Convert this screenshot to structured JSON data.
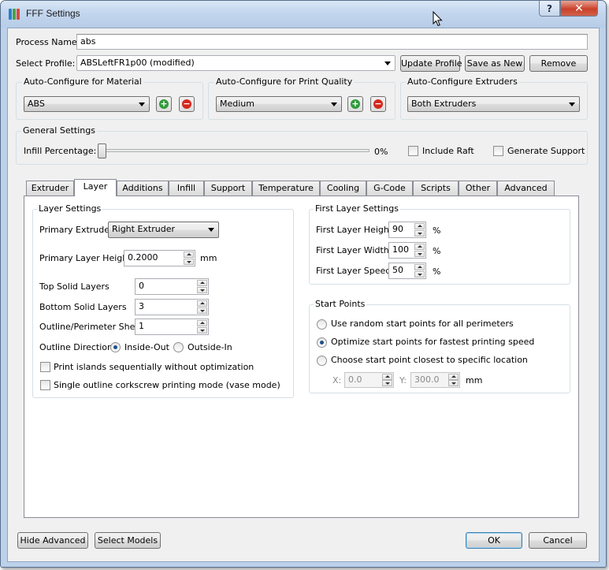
{
  "window": {
    "title": "FFF Settings",
    "help_label": "?",
    "close_label": "✕",
    "icon": "app-icon"
  },
  "process": {
    "name_label": "Process Name:",
    "name_value": "abs",
    "profile_label": "Select Profile:",
    "profile_value": "ABSLeftFR1p00 (modified)",
    "update_button": "Update Profile",
    "save_as_button": "Save as New",
    "remove_button": "Remove"
  },
  "auto_material": {
    "title": "Auto-Configure for Material",
    "value": "ABS"
  },
  "auto_quality": {
    "title": "Auto-Configure for Print Quality",
    "value": "Medium"
  },
  "auto_extruders": {
    "title": "Auto-Configure Extruders",
    "value": "Both Extruders"
  },
  "add_icon": "+",
  "remove_icon": "−",
  "general": {
    "title": "General Settings",
    "infill_label": "Infill Percentage:",
    "infill_value": "0%",
    "infill_fraction": 0,
    "raft_label": "Include Raft",
    "raft_checked": false,
    "support_label": "Generate Support",
    "support_checked": false
  },
  "tabs": [
    {
      "label": "Extruder"
    },
    {
      "label": "Layer",
      "active": true
    },
    {
      "label": "Additions"
    },
    {
      "label": "Infill"
    },
    {
      "label": "Support"
    },
    {
      "label": "Temperature"
    },
    {
      "label": "Cooling"
    },
    {
      "label": "G-Code"
    },
    {
      "label": "Scripts"
    },
    {
      "label": "Other"
    },
    {
      "label": "Advanced"
    }
  ],
  "layer_settings": {
    "title": "Layer Settings",
    "primary_extruder_label": "Primary Extruder",
    "primary_extruder_value": "Right Extruder",
    "primary_height_label": "Primary Layer Height",
    "primary_height_value": "0.2000",
    "primary_height_unit": "mm",
    "top_solid_label": "Top Solid Layers",
    "top_solid_value": "0",
    "bottom_solid_label": "Bottom Solid Layers",
    "bottom_solid_value": "3",
    "outline_shells_label": "Outline/Perimeter Shells",
    "outline_shells_value": "1",
    "outline_direction_label": "Outline Direction:",
    "inside_out_label": "Inside-Out",
    "outside_in_label": "Outside-In",
    "inside_out_checked": true,
    "print_islands_label": "Print islands sequentially without optimization",
    "vase_mode_label": "Single outline corkscrew printing mode (vase mode)"
  },
  "first_layer": {
    "title": "First Layer Settings",
    "height_label": "First Layer Height",
    "height_value": "90",
    "width_label": "First Layer Width",
    "width_value": "100",
    "speed_label": "First Layer Speed",
    "speed_value": "50",
    "unit": "%"
  },
  "start_points": {
    "title": "Start Points",
    "option_random": "Use random start points for all perimeters",
    "option_optimize": "Optimize start points for fastest printing speed",
    "option_specific": "Choose start point closest to specific location",
    "selected": "optimize",
    "x_label": "X:",
    "x_value": "0.0",
    "y_label": "Y:",
    "y_value": "300.0",
    "unit": "mm"
  },
  "footer": {
    "hide_advanced": "Hide Advanced",
    "select_models": "Select Models",
    "ok": "OK",
    "cancel": "Cancel"
  }
}
